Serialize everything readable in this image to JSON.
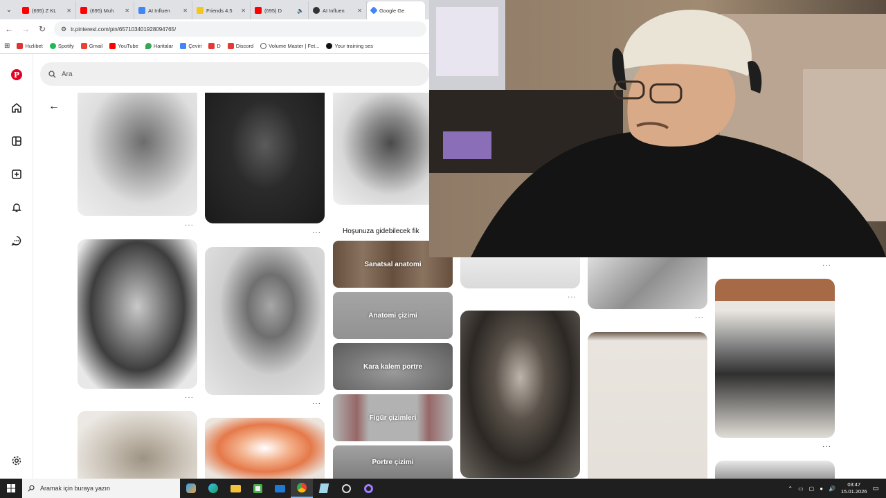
{
  "browser": {
    "tabs": [
      {
        "title": "(695) Z KL",
        "color": "#ff0000"
      },
      {
        "title": "(695) Muh",
        "color": "#ff0000"
      },
      {
        "title": "AI Influen",
        "color": "#4285f4"
      },
      {
        "title": "Friends 4.5",
        "color": "#f5c518"
      },
      {
        "title": "(695) D",
        "color": "#ff0000"
      },
      {
        "title": "AI Influen",
        "color": "#333333"
      },
      {
        "title": "Google Ge",
        "color": "#4285f4"
      }
    ],
    "url": "tr.pinterest.com/pin/657103401928094765/",
    "bookmarks": [
      "Hızlıbet",
      "Spotify",
      "Gmail",
      "YouTube",
      "Haritalar",
      "Çeviri",
      "D",
      "Discord",
      "Volume Master | Fet...",
      "Your training ses"
    ]
  },
  "pinterest": {
    "search_placeholder": "Ara",
    "suggest_heading": "Hoşunuza gidebilecek fik",
    "categories": [
      "Sanatsal anatomi",
      "Anatomi çizimi",
      "Kara kalem portre",
      "Figür çizimleri",
      "Portre çizimi"
    ],
    "more_dots": "···"
  },
  "taskbar": {
    "search_placeholder": "Aramak için buraya yazın",
    "time": "03:47",
    "date": "15.01.2026"
  },
  "colors": {
    "pinterest_red": "#e60023",
    "taskbar_bg": "#1f1f1f"
  }
}
